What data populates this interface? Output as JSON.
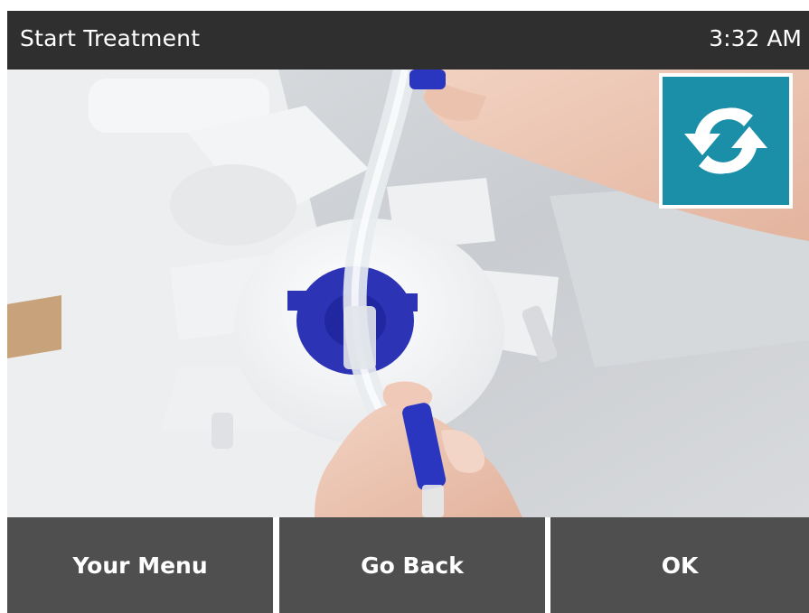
{
  "header": {
    "title": "Start Treatment",
    "time": "3:32 AM"
  },
  "media": {
    "icon": "treatment-setup-photo"
  },
  "refresh_button": {
    "icon": "refresh-icon",
    "color": "#1b8ea8"
  },
  "softkeys": {
    "left": "Your Menu",
    "center": "Go Back",
    "right": "OK"
  },
  "colors": {
    "header_bg": "#2f2f2f",
    "softkey_bg": "#4f4f4f",
    "accent": "#1b8ea8"
  }
}
